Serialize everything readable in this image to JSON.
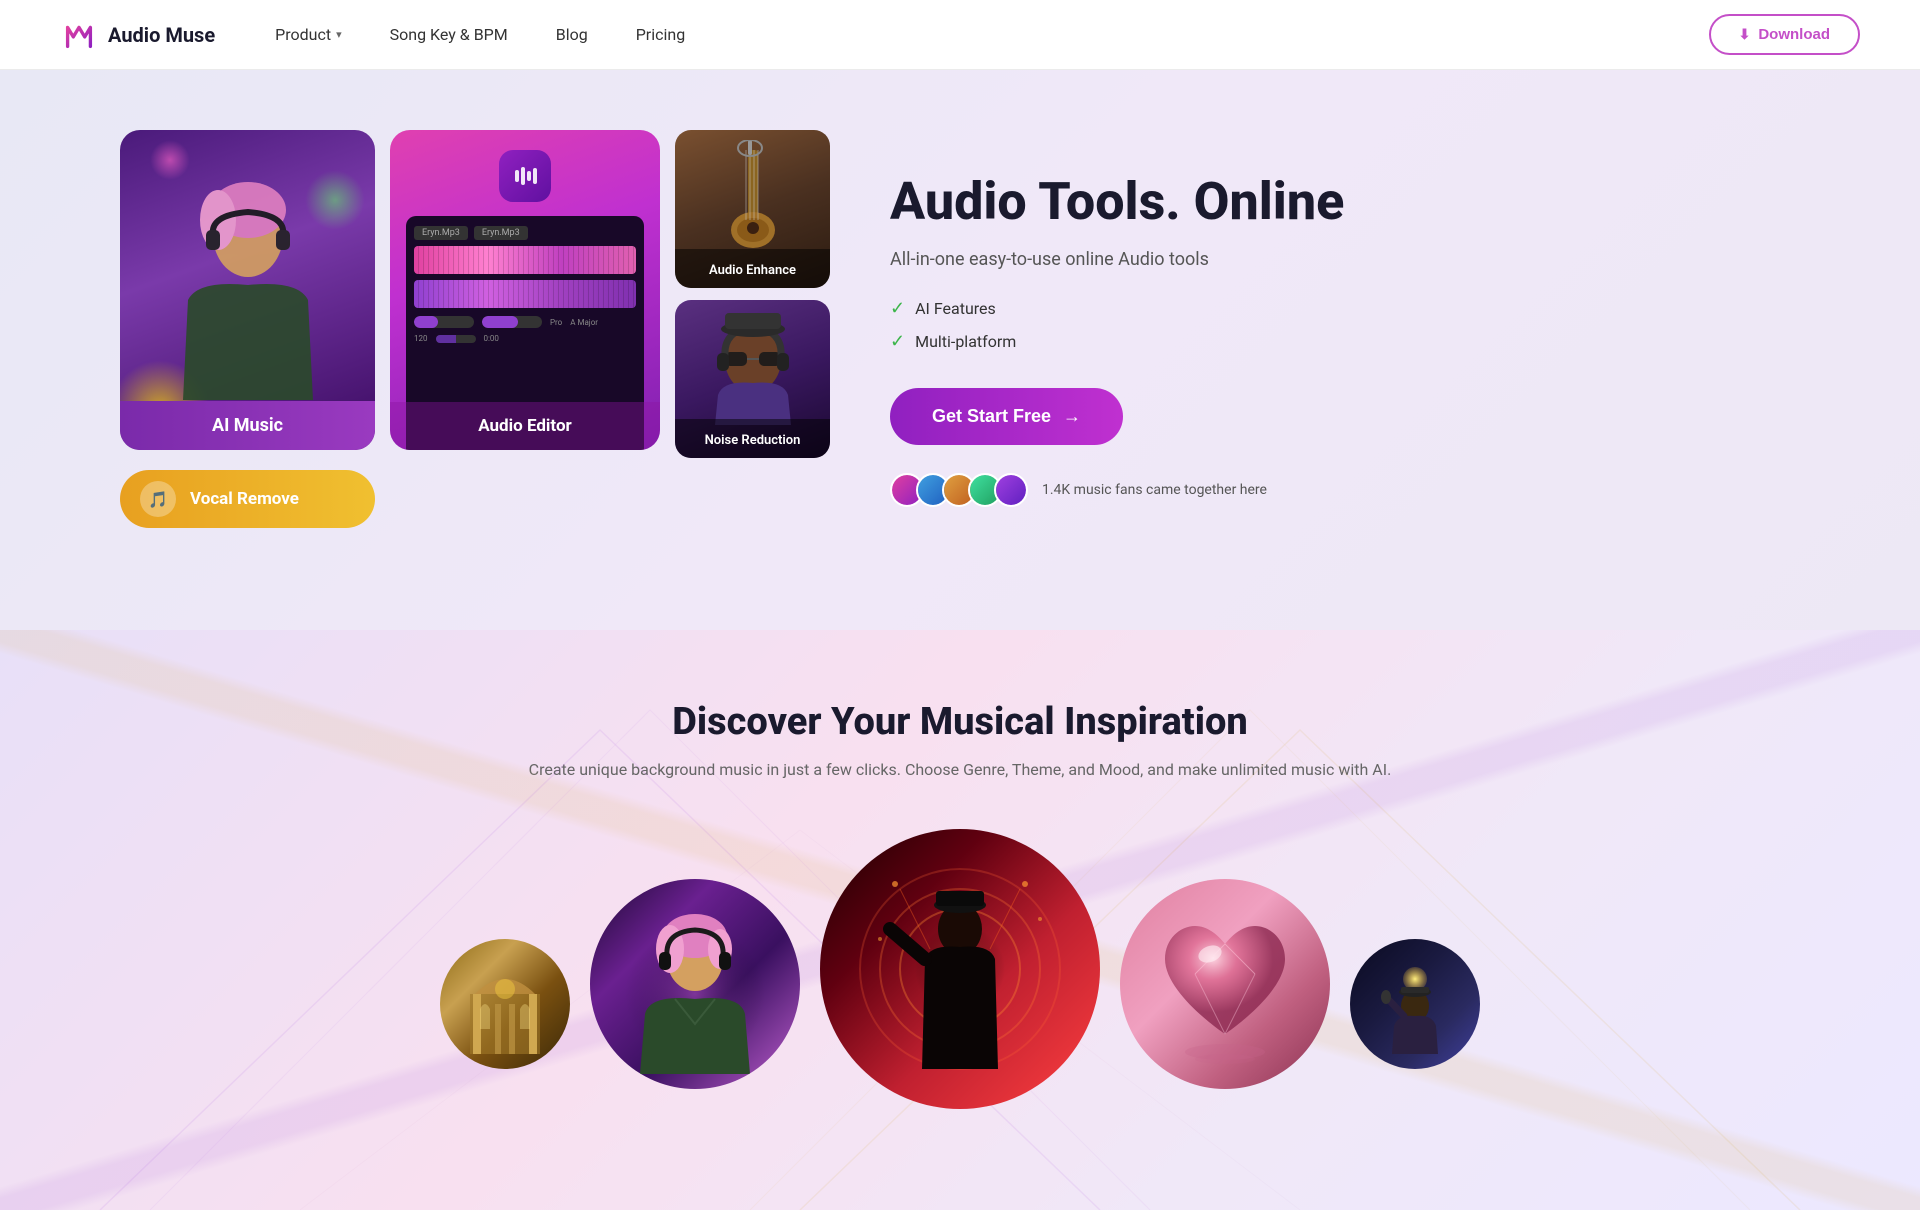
{
  "nav": {
    "logo_text": "Audio Muse",
    "links": [
      {
        "label": "Product",
        "has_dropdown": true
      },
      {
        "label": "Song Key & BPM",
        "has_dropdown": false
      },
      {
        "label": "Blog",
        "has_dropdown": false
      },
      {
        "label": "Pricing",
        "has_dropdown": false
      }
    ],
    "download_label": "Download"
  },
  "hero": {
    "title": "Audio Tools. Online",
    "subtitle": "All-in-one easy-to-use online Audio tools",
    "features": [
      {
        "label": "AI Features"
      },
      {
        "label": "Multi-platform"
      }
    ],
    "cta_label": "Get Start Free",
    "cta_arrow": "→",
    "social_proof_text": "1.4K music fans came together here"
  },
  "cards": {
    "ai_music_label": "AI Music",
    "vocal_remove_label": "Vocal Remove",
    "audio_editor_label": "Audio Editor",
    "audio_enhance_label": "Audio Enhance",
    "noise_reduction_label": "Noise Reduction"
  },
  "discover": {
    "title": "Discover Your Musical Inspiration",
    "subtitle": "Create unique background music in just a few clicks. Choose Genre, Theme, and Mood, and make unlimited music with AI.",
    "circles": [
      {
        "id": "cathedral",
        "size": "sm",
        "type": "cathedral"
      },
      {
        "id": "pink-singer",
        "size": "md",
        "type": "pink_singer"
      },
      {
        "id": "red-man",
        "size": "lg",
        "type": "red_man"
      },
      {
        "id": "heart",
        "size": "md",
        "type": "heart"
      },
      {
        "id": "performer",
        "size": "sm",
        "type": "performer"
      }
    ]
  },
  "colors": {
    "brand_purple": "#9020c0",
    "brand_pink": "#e040a0",
    "brand_gold": "#e8a020",
    "check_green": "#3cb54a"
  }
}
